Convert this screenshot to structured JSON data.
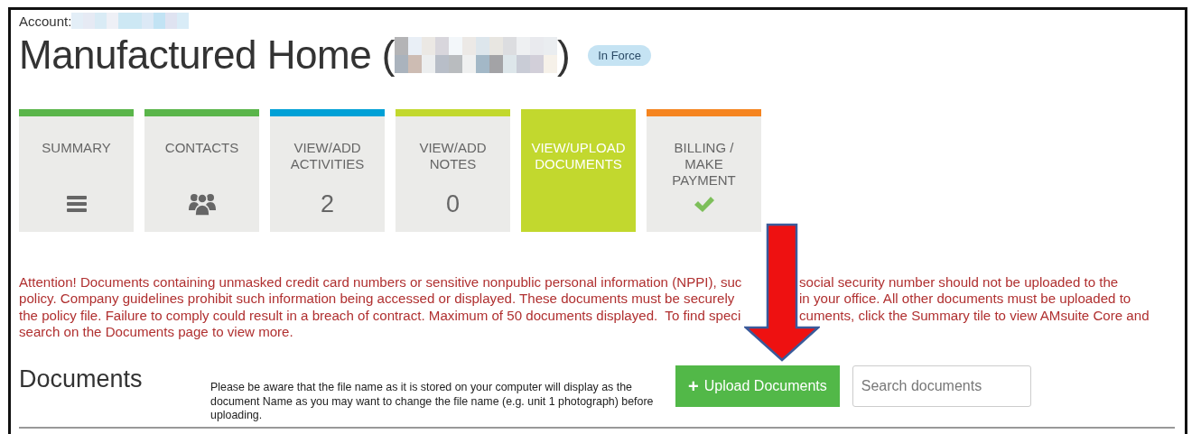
{
  "account_label": "Account:",
  "title": {
    "prefix": "Manufactured Home (",
    "suffix": ")"
  },
  "status_badge": "In Force",
  "tiles": [
    {
      "label": "SUMMARY",
      "kind": "list",
      "color": "#5ab54a",
      "selected": false
    },
    {
      "label": "CONTACTS",
      "kind": "people",
      "color": "#5ab54a",
      "selected": false
    },
    {
      "label": "VIEW/ADD ACTIVITIES",
      "kind": "count",
      "value": "2",
      "color": "#00a0d6",
      "selected": false
    },
    {
      "label": "VIEW/ADD NOTES",
      "kind": "count",
      "value": "0",
      "color": "#c2d82e",
      "selected": false
    },
    {
      "label": "VIEW/UPLOAD DOCUMENTS",
      "kind": "blank",
      "color": "#c2d82e",
      "selected": true
    },
    {
      "label": "BILLING / MAKE PAYMENT",
      "kind": "check",
      "color": "#f5841f",
      "selected": false
    }
  ],
  "attention_lines": [
    {
      "left": "Attention! Documents containing unmasked credit card numbers or sensitive nonpublic personal information (NPPI), suc",
      "right": "social security number should not be uploaded to the"
    },
    {
      "left": "policy. Company guidelines prohibit such information being accessed or displayed. These documents must be securely",
      "right": "in your office. All other documents must be uploaded to"
    },
    {
      "left": "the policy file. Failure to comply could result in a breach of contract. Maximum of 50 documents displayed.  To find speci",
      "right": "cuments, click the Summary tile to view AMsuite Core and"
    },
    {
      "left": "search on the Documents page to view more."
    }
  ],
  "documents": {
    "heading": "Documents",
    "note": "Please be aware that the file name as it is stored on your computer will display as the document Name as you may want to change the file name (e.g. unit 1 photograph) before uploading.",
    "upload_button": "Upload Documents",
    "upload_icon": "+",
    "search_placeholder": "Search documents"
  }
}
